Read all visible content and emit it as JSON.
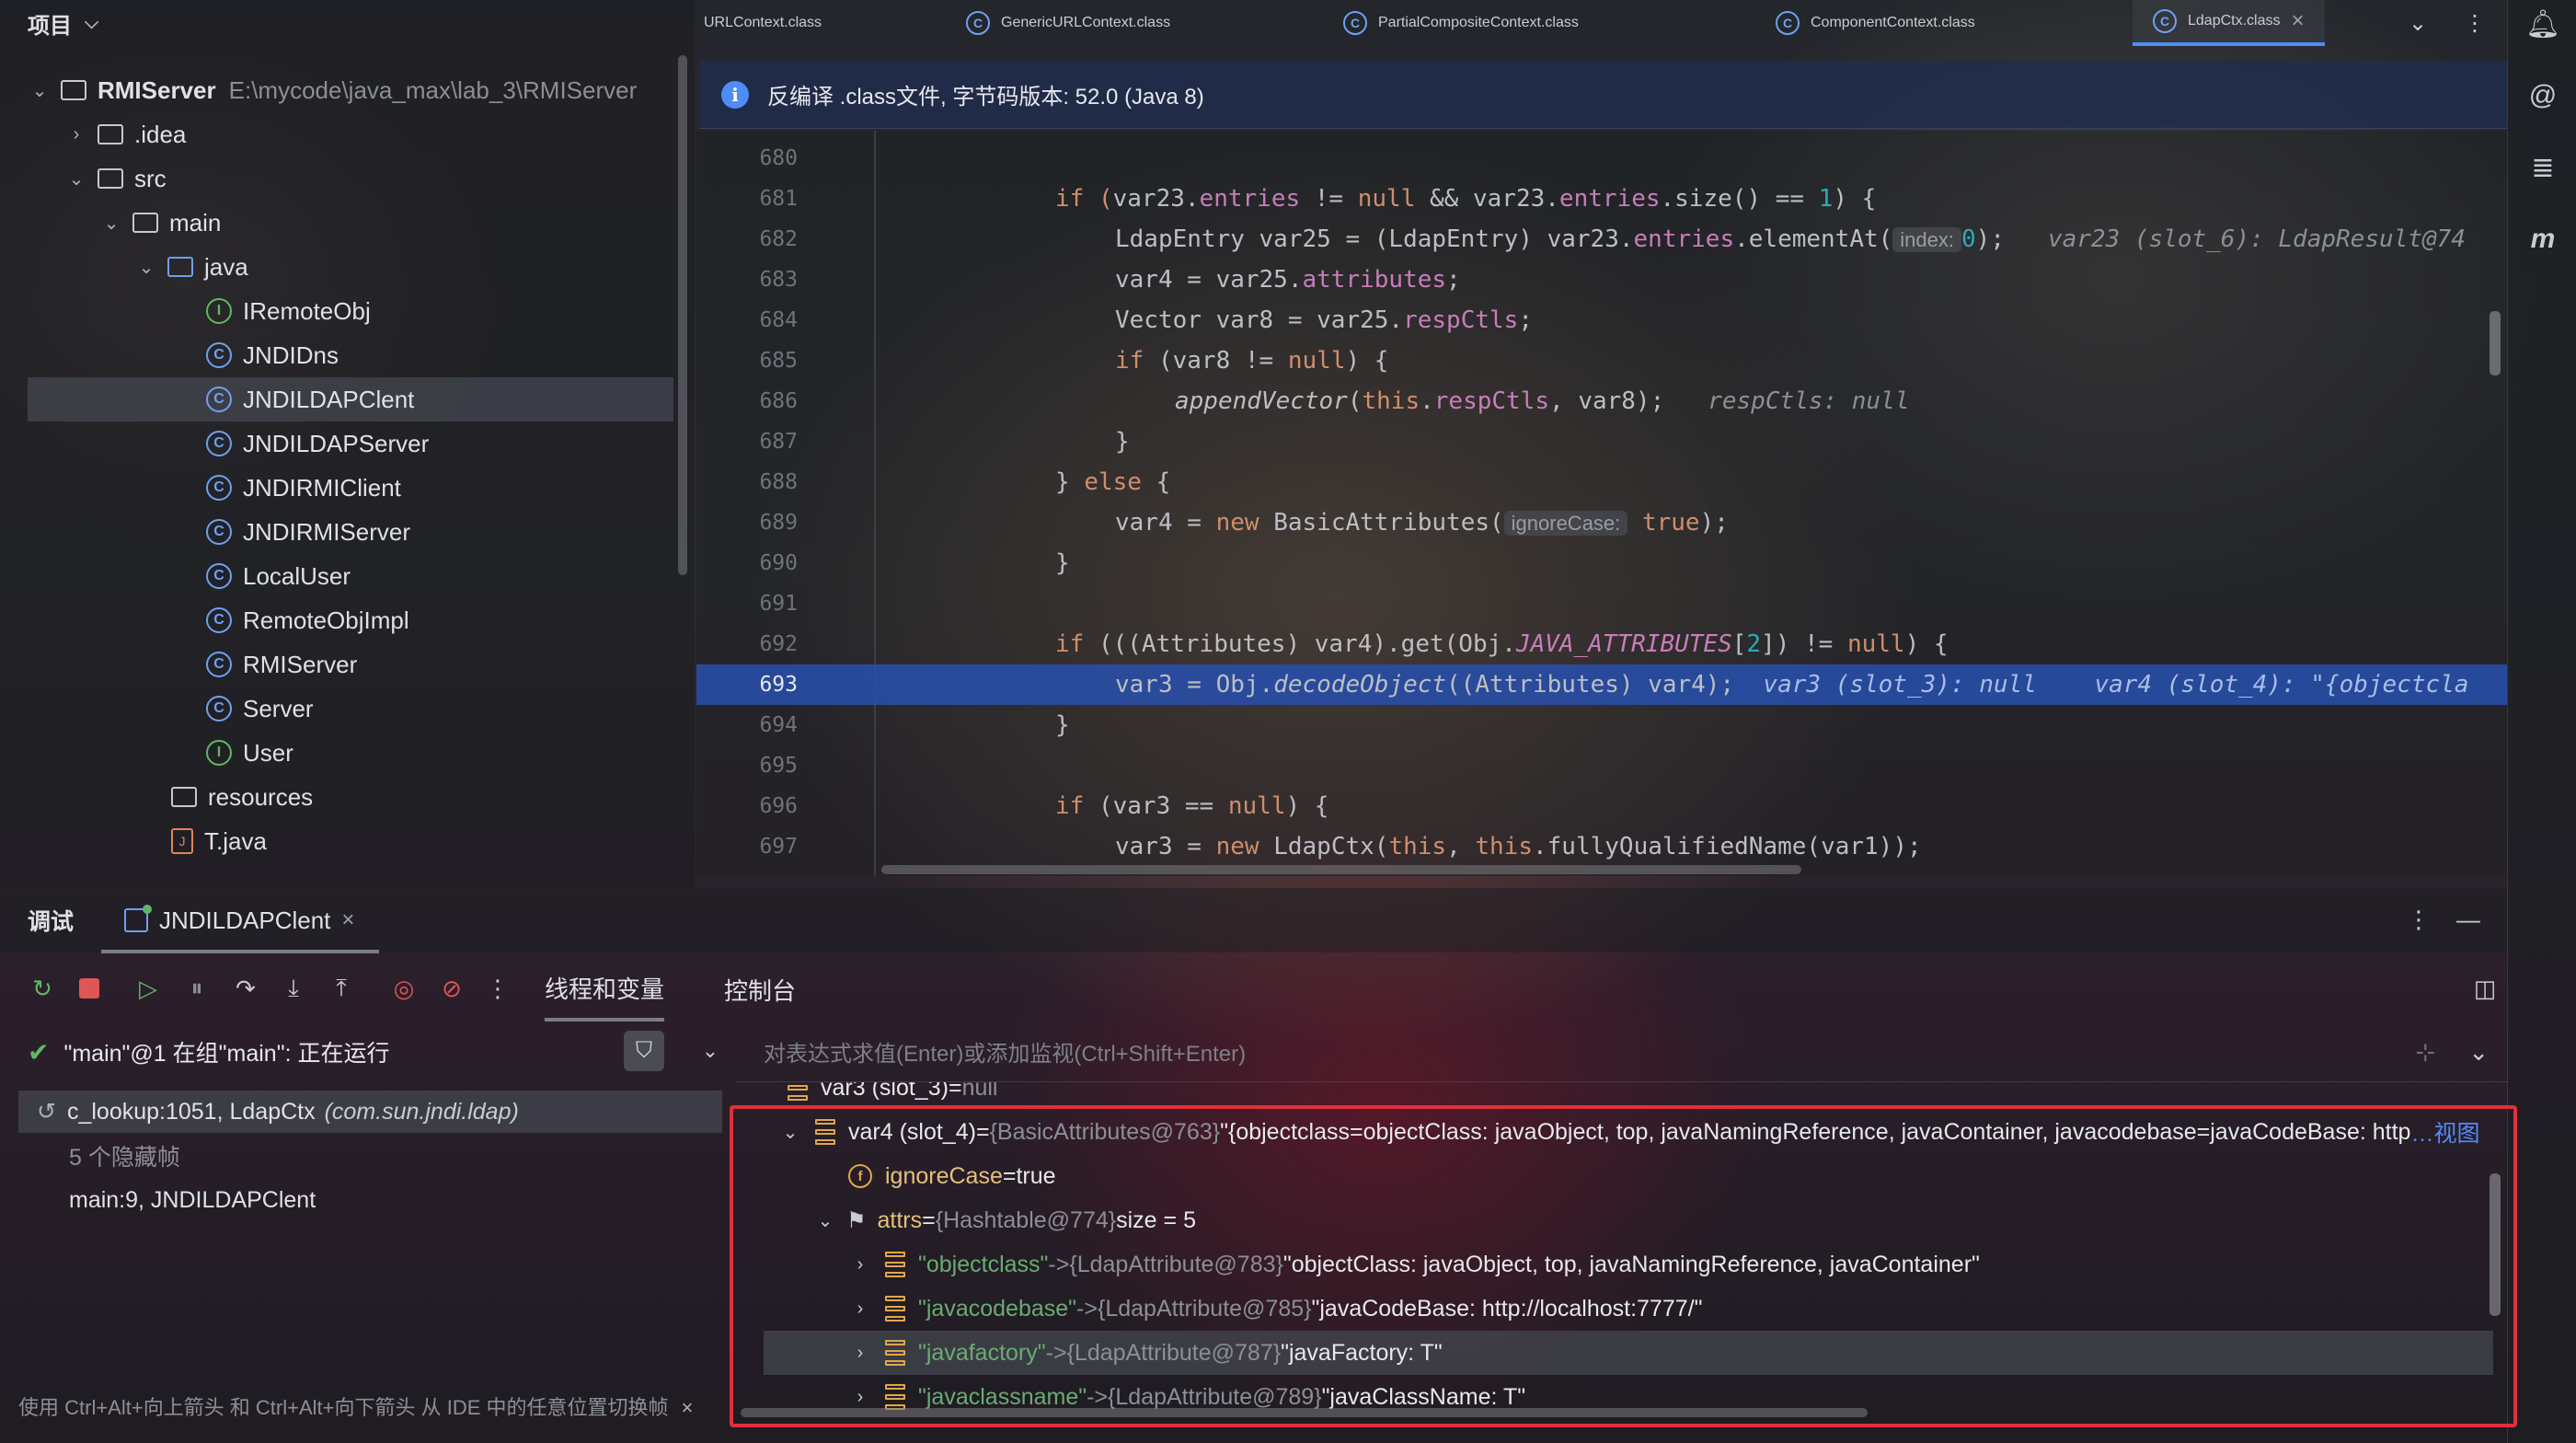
{
  "project": {
    "title": "项目",
    "tree": [
      {
        "label": "RMIServer",
        "path": "E:\\mycode\\java_max\\lab_3\\RMIServer",
        "icon": "module-folder-icon"
      },
      {
        "label": ".idea",
        "icon": "folder-icon"
      },
      {
        "label": "src",
        "icon": "folder-icon"
      },
      {
        "label": "main",
        "icon": "folder-icon"
      },
      {
        "label": "java",
        "icon": "source-folder-icon"
      },
      {
        "label": "IRemoteObj",
        "icon": "interface-icon"
      },
      {
        "label": "JNDIDns",
        "icon": "class-icon"
      },
      {
        "label": "JNDILDAPClent",
        "icon": "class-icon"
      },
      {
        "label": "JNDILDAPServer",
        "icon": "class-icon"
      },
      {
        "label": "JNDIRMIClient",
        "icon": "class-icon"
      },
      {
        "label": "JNDIRMIServer",
        "icon": "class-icon"
      },
      {
        "label": "LocalUser",
        "icon": "class-icon"
      },
      {
        "label": "RemoteObjImpl",
        "icon": "class-icon"
      },
      {
        "label": "RMIServer",
        "icon": "class-icon"
      },
      {
        "label": "Server",
        "icon": "class-icon"
      },
      {
        "label": "User",
        "icon": "interface-icon"
      },
      {
        "label": "resources",
        "icon": "resources-folder-icon"
      },
      {
        "label": "T.java",
        "icon": "java-file-icon"
      }
    ]
  },
  "tabs": [
    {
      "label": "URLContext.class"
    },
    {
      "label": "GenericURLContext.class"
    },
    {
      "label": "PartialCompositeContext.class"
    },
    {
      "label": "ComponentContext.class"
    },
    {
      "label": "LdapCtx.class",
      "active": true
    }
  ],
  "banner": {
    "text": "反编译 .class文件, 字节码版本: 52.0 (Java 8)"
  },
  "code": {
    "current_line": 693,
    "line_numbers": [
      "680",
      "681",
      "682",
      "683",
      "684",
      "685",
      "686",
      "687",
      "688",
      "689",
      "690",
      "691",
      "692",
      "693",
      "694",
      "695",
      "696",
      "697"
    ],
    "lines": {
      "l681": {
        "a": "if (",
        "b": "var23.",
        "c": "entries",
        "d": " != ",
        "e": "null",
        "f": " && var23.",
        "g": "entries",
        "h": ".size() == ",
        "i": "1",
        "j": ") {"
      },
      "l682": {
        "a": "LdapEntry var25 = (LdapEntry) var23.",
        "b": "entries",
        "c": ".elementAt(",
        "hint": "index:",
        "d": "0",
        "e": ");",
        "inline": "var23 (slot_6): LdapResult@74"
      },
      "l683": {
        "a": "var4 = var25.",
        "b": "attributes",
        "c": ";"
      },
      "l684": {
        "a": "Vector var8 = var25.",
        "b": "respCtls",
        "c": ";"
      },
      "l685": {
        "a": "if",
        "b": " (var8 != ",
        "c": "null",
        "d": ") {"
      },
      "l686": {
        "a": "appendVector",
        "b": "(",
        "c": "this",
        "d": ".",
        "e": "respCtls",
        "f": ", var8);",
        "inline": "respCtls: null"
      },
      "l687": {
        "a": "}"
      },
      "l688": {
        "a": "} ",
        "b": "else",
        "c": " {"
      },
      "l689": {
        "a": "var4 = ",
        "b": "new",
        "c": " BasicAttributes(",
        "hint": "ignoreCase:",
        "d": "true",
        "e": ");"
      },
      "l690": {
        "a": "}"
      },
      "l692": {
        "a": "if",
        "b": " (((Attributes) var4).get(Obj.",
        "c": "JAVA_ATTRIBUTES",
        "d": "[",
        "e": "2",
        "f": "]) != ",
        "g": "null",
        "h": ") {"
      },
      "l693": {
        "a": "var3 = Obj.",
        "b": "decodeObject",
        "c": "((Attributes) var4);",
        "inline1": "var3 (slot_3): null",
        "inline2": "var4 (slot_4): \"{objectcla"
      },
      "l694": {
        "a": "}"
      },
      "l696": {
        "a": "if",
        "b": " (var3 == ",
        "c": "null",
        "d": ") {"
      },
      "l697": {
        "a": "var3 = ",
        "b": "new",
        "c": " LdapCtx(",
        "d": "this",
        "e": ", ",
        "f": "this",
        "g": ".fullyQualifiedName(var1));"
      }
    }
  },
  "debug": {
    "title": "调试",
    "session_tab": "JNDILDAPClent",
    "subtabs": {
      "threads": "线程和变量",
      "console": "控制台"
    },
    "thread": "\"main\"@1 在组\"main\": 正在运行",
    "frames": [
      {
        "method": "c_lookup:1051, LdapCtx",
        "pkg": "(com.sun.jndi.ldap)"
      },
      {
        "method": "5 个隐藏帧",
        "pkg": ""
      },
      {
        "method": "main:9, JNDILDAPClent",
        "pkg": ""
      }
    ],
    "expr_placeholder": "对表达式求值(Enter)或添加监视(Ctrl+Shift+Enter)",
    "hint": "使用 Ctrl+Alt+向上箭头 和 Ctrl+Alt+向下箭头 从 IDE 中的任意位置切换帧",
    "variables": {
      "var3": {
        "name": "var3 (slot_3)",
        "eq": " = ",
        "value": "null"
      },
      "var4": {
        "name": "var4 (slot_4)",
        "eq": " = ",
        "type": "{BasicAttributes@763}",
        "value": "\"{objectclass=objectClass: javaObject, top, javaNamingReference, javaContainer, javacodebase=javaCodeBase: http",
        "more": "…视图"
      },
      "ignoreCase": {
        "name": "ignoreCase",
        "eq": " = ",
        "value": "true"
      },
      "attrs": {
        "name": "attrs",
        "eq": " = ",
        "type": "{Hashtable@774}",
        "value": " size = 5"
      },
      "entries": [
        {
          "key": "\"objectclass\"",
          "arrow": " -> ",
          "type": "{LdapAttribute@783}",
          "value": "\"objectClass: javaObject, top, javaNamingReference, javaContainer\""
        },
        {
          "key": "\"javacodebase\"",
          "arrow": " -> ",
          "type": "{LdapAttribute@785}",
          "value": "\"javaCodeBase: http://localhost:7777/\""
        },
        {
          "key": "\"javafactory\"",
          "arrow": " -> ",
          "type": "{LdapAttribute@787}",
          "value": "\"javaFactory: T\""
        },
        {
          "key": "\"javaclassname\"",
          "arrow": " -> ",
          "type": "{LdapAttribute@789}",
          "value": "\"javaClassName: T\""
        }
      ]
    }
  },
  "colors": {
    "accent": "#4e8cf7",
    "highlight": "#284eaa",
    "annotation_box": "#e0303c"
  }
}
